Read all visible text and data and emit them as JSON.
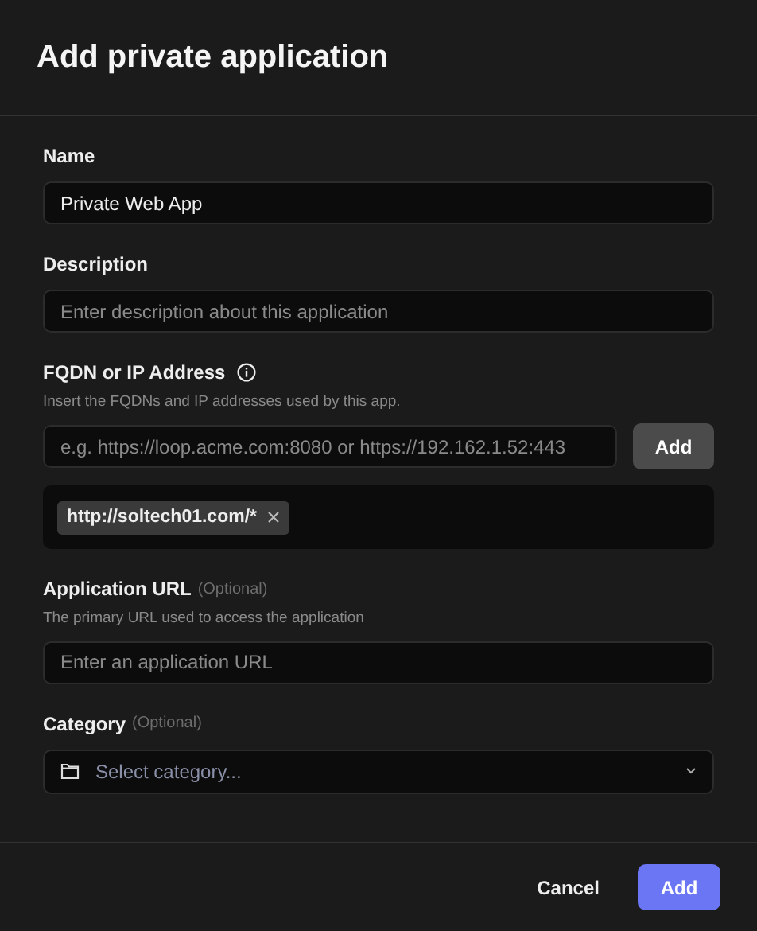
{
  "dialog": {
    "title": "Add private application"
  },
  "fields": [
    {
      "kind": "text",
      "label": "Name",
      "value": "Private Web App"
    },
    {
      "kind": "text",
      "label": "Description",
      "placeholder": "Enter description about this application"
    },
    {
      "kind": "tags",
      "label": "FQDN or IP Address",
      "info": true,
      "help": "Insert the FQDNs and IP addresses used by this app.",
      "placeholder": "e.g. https://loop.acme.com:8080 or https://192.162.1.52:443",
      "button": "Add",
      "tags": [
        "http://soltech01.com/*"
      ]
    },
    {
      "kind": "text",
      "label": "Application URL",
      "optional": "(Optional)",
      "help": "The primary URL used to access the application",
      "placeholder": "Enter an application URL"
    },
    {
      "kind": "select",
      "label": "Category",
      "optional": "(Optional)",
      "placeholder": "Select category..."
    }
  ],
  "footer": {
    "cancel": "Cancel",
    "submit": "Add"
  }
}
